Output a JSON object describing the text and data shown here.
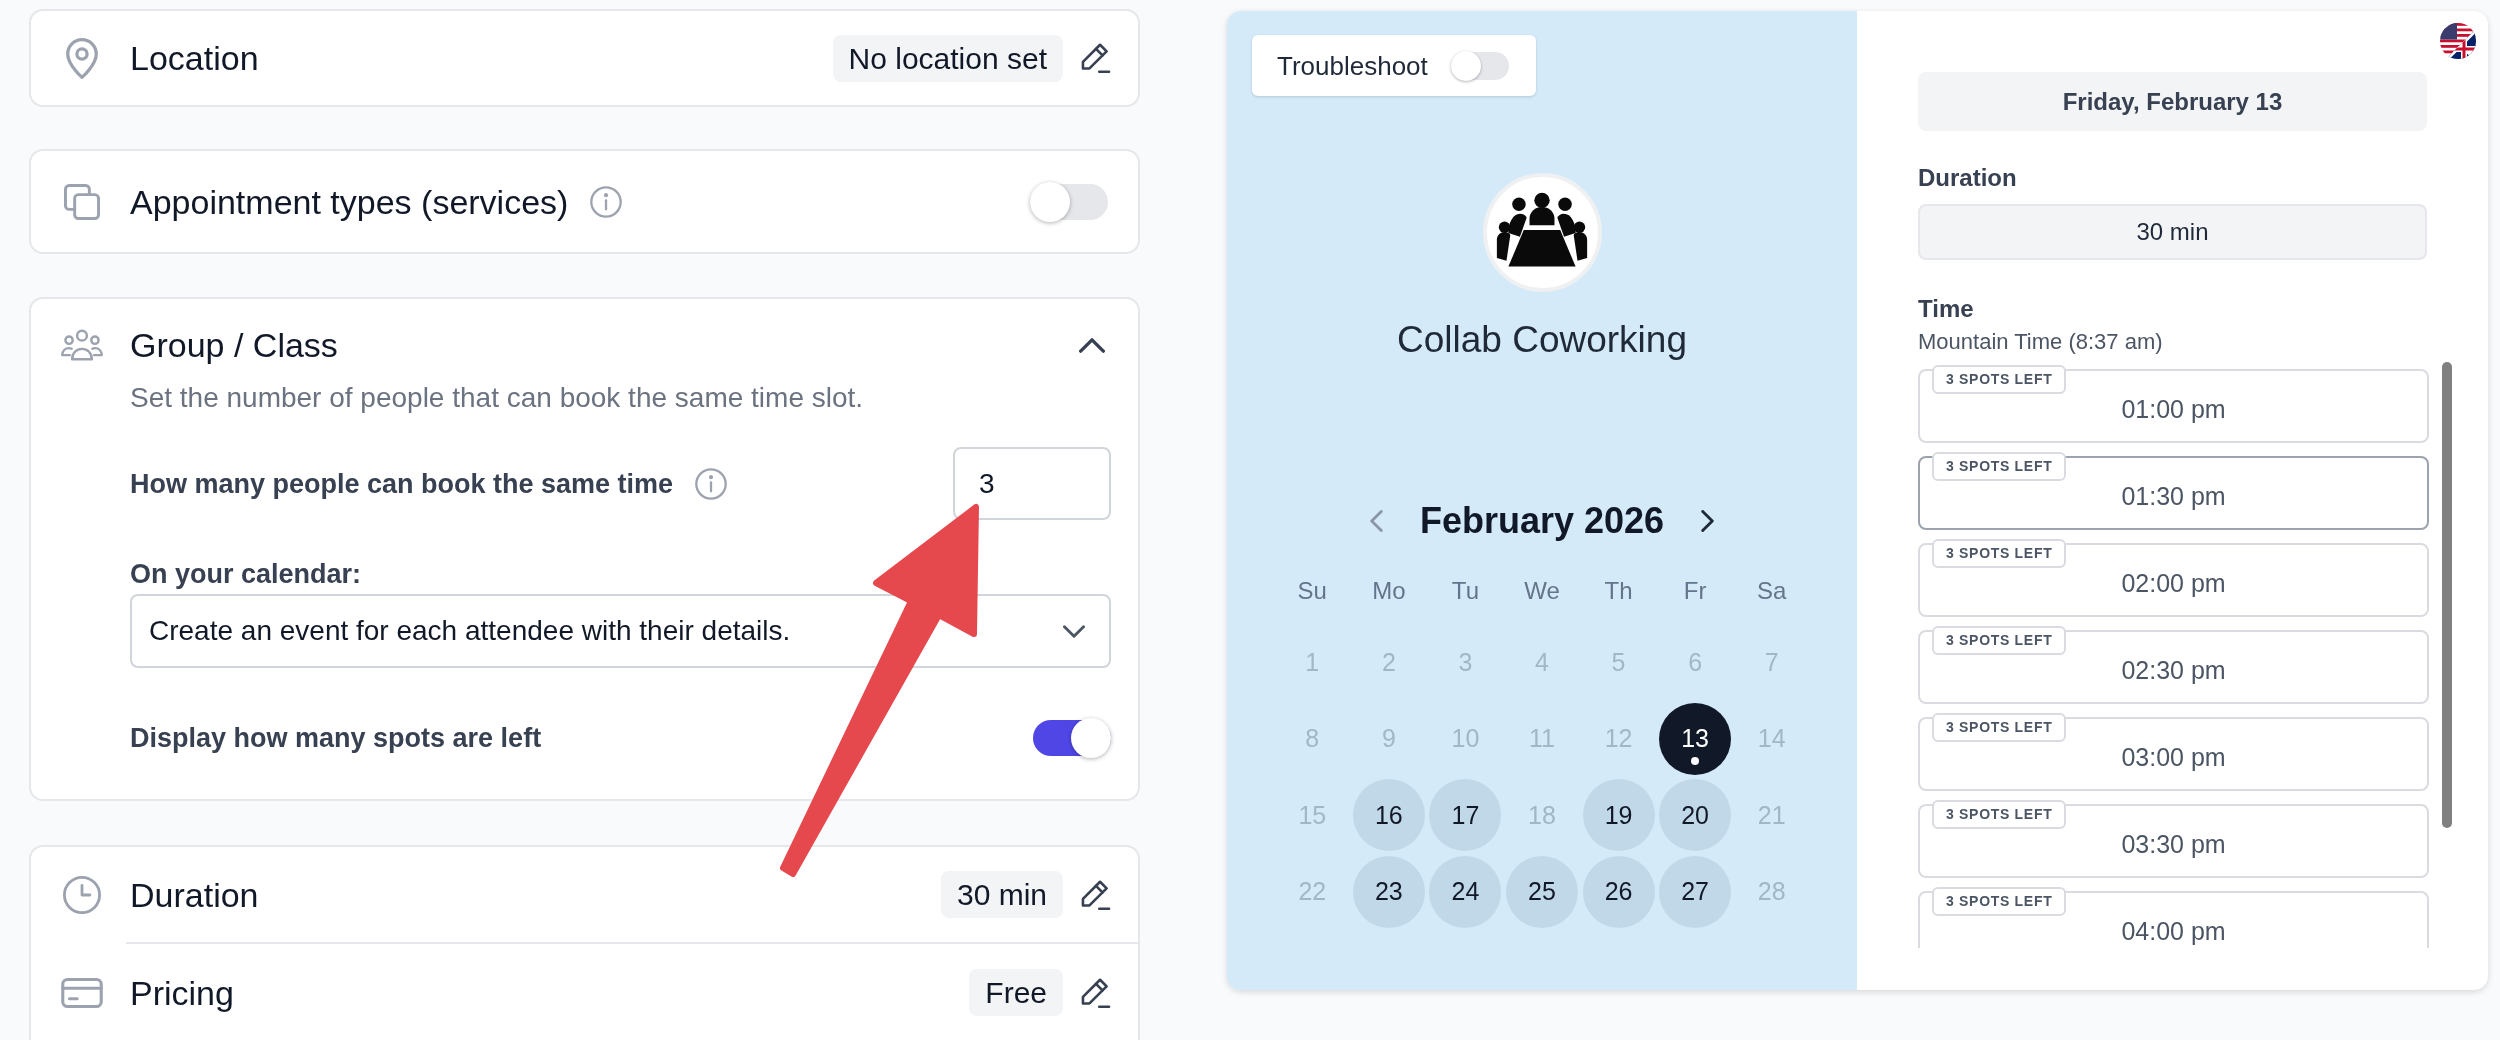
{
  "settings": {
    "location": {
      "label": "Location",
      "value": "No location set"
    },
    "appointment_types": {
      "label": "Appointment types (services)",
      "on": false
    },
    "group_class": {
      "title": "Group / Class",
      "expanded": true,
      "description": "Set the number of people that can book the same time slot.",
      "capacity": {
        "label": "How many people can book the same time",
        "value": "3"
      },
      "calendar_option": {
        "label": "On your calendar:",
        "value": "Create an event for each attendee with their details."
      },
      "spots_left": {
        "label": "Display how many spots are left",
        "on": true
      }
    },
    "duration": {
      "label": "Duration",
      "value": "30 min"
    },
    "pricing": {
      "label": "Pricing",
      "value": "Free"
    }
  },
  "preview": {
    "troubleshoot": {
      "label": "Troubleshoot",
      "on": false
    },
    "business_name": "Collab Coworking",
    "calendar": {
      "month": "February 2026",
      "prev_disabled": true,
      "weekdays": [
        "Su",
        "Mo",
        "Tu",
        "We",
        "Th",
        "Fr",
        "Sa"
      ],
      "days": [
        {
          "day": "1",
          "available": false,
          "selected": false,
          "today": false
        },
        {
          "day": "2",
          "available": false,
          "selected": false,
          "today": false
        },
        {
          "day": "3",
          "available": false,
          "selected": false,
          "today": false
        },
        {
          "day": "4",
          "available": false,
          "selected": false,
          "today": false
        },
        {
          "day": "5",
          "available": false,
          "selected": false,
          "today": false
        },
        {
          "day": "6",
          "available": false,
          "selected": false,
          "today": false
        },
        {
          "day": "7",
          "available": false,
          "selected": false,
          "today": false
        },
        {
          "day": "8",
          "available": false,
          "selected": false,
          "today": false
        },
        {
          "day": "9",
          "available": false,
          "selected": false,
          "today": false
        },
        {
          "day": "10",
          "available": false,
          "selected": false,
          "today": false
        },
        {
          "day": "11",
          "available": false,
          "selected": false,
          "today": false
        },
        {
          "day": "12",
          "available": false,
          "selected": false,
          "today": false
        },
        {
          "day": "13",
          "available": true,
          "selected": true,
          "today": true
        },
        {
          "day": "14",
          "available": false,
          "selected": false,
          "today": false
        },
        {
          "day": "15",
          "available": false,
          "selected": false,
          "today": false
        },
        {
          "day": "16",
          "available": true,
          "selected": false,
          "today": false
        },
        {
          "day": "17",
          "available": true,
          "selected": false,
          "today": false
        },
        {
          "day": "18",
          "available": false,
          "selected": false,
          "today": false
        },
        {
          "day": "19",
          "available": true,
          "selected": false,
          "today": false
        },
        {
          "day": "20",
          "available": true,
          "selected": false,
          "today": false
        },
        {
          "day": "21",
          "available": false,
          "selected": false,
          "today": false
        },
        {
          "day": "22",
          "available": false,
          "selected": false,
          "today": false
        },
        {
          "day": "23",
          "available": true,
          "selected": false,
          "today": false
        },
        {
          "day": "24",
          "available": true,
          "selected": false,
          "today": false
        },
        {
          "day": "25",
          "available": true,
          "selected": false,
          "today": false
        },
        {
          "day": "26",
          "available": true,
          "selected": false,
          "today": false
        },
        {
          "day": "27",
          "available": true,
          "selected": false,
          "today": false
        },
        {
          "day": "28",
          "available": false,
          "selected": false,
          "today": false
        }
      ]
    },
    "selected_date": "Friday, February 13",
    "duration": {
      "label": "Duration",
      "value": "30 min"
    },
    "time": {
      "label": "Time",
      "timezone": "Mountain Time (8:37 am)",
      "slots": [
        {
          "badge": "3 SPOTS LEFT",
          "time": "01:00 pm",
          "selected": false
        },
        {
          "badge": "3 SPOTS LEFT",
          "time": "01:30 pm",
          "selected": true
        },
        {
          "badge": "3 SPOTS LEFT",
          "time": "02:00 pm",
          "selected": false
        },
        {
          "badge": "3 SPOTS LEFT",
          "time": "02:30 pm",
          "selected": false
        },
        {
          "badge": "3 SPOTS LEFT",
          "time": "03:00 pm",
          "selected": false
        },
        {
          "badge": "3 SPOTS LEFT",
          "time": "03:30 pm",
          "selected": false
        },
        {
          "badge": "3 SPOTS LEFT",
          "time": "04:00 pm",
          "selected": false
        }
      ]
    }
  }
}
